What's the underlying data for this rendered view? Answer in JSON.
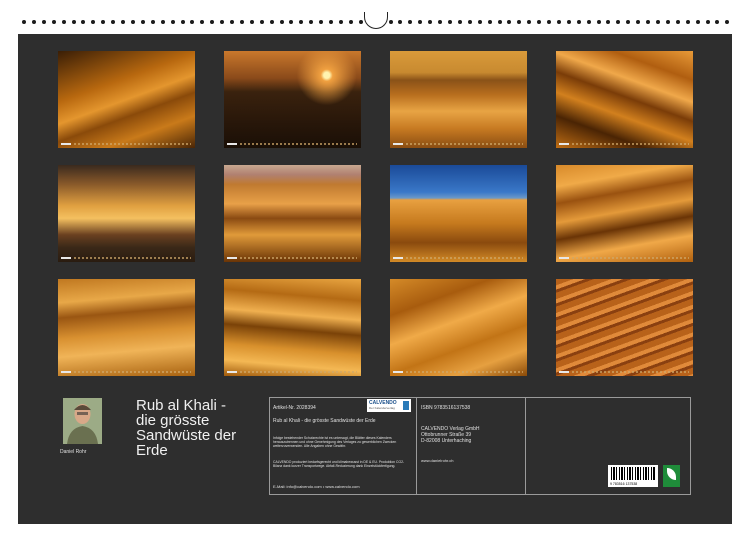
{
  "author": {
    "name": "Daniel Rohr"
  },
  "title": "Rub al Khali - die grösste Sandwüste der Erde",
  "title_lines": [
    "Rub al Khali -",
    "die grösste",
    "Sandwüste der",
    "Erde"
  ],
  "info": {
    "article": "Artikel-Nr. 2028394",
    "subtitle": "Rub al Khali - die grösste Sandwüste der Erde",
    "copyright": "Infolge bestehender Schutzrechte ist es untersagt, die Blätter dieses Kalenders herauszutrennen und ohne Genehmigung des Verlages zu gewerblichen Zwecken weiterzuverwenden. Alle Angaben ohne Gewähr.",
    "production": "CALVENDO produziert bedarfsgerecht und klimabewusst in DE & EU. Produktion CO2-Bilanz dank kurzer Transportwege. Abfall-Reduzierung dank Einzelstückfertigung.",
    "contact": "E-Mail: info@calvendo.com • www.calvendo.com",
    "isbn": "ISBN 9783516137538",
    "publisher": [
      "CALVENDO Verlag GmbH",
      "Ottobrunner Straße 39",
      "D-82008 Unterhaching"
    ],
    "website": "www.danielrohr.ch",
    "barcode_number": "9 783516 137538"
  },
  "logo": {
    "name": "CALVENDO",
    "tagline": "Der Kalenderverlag"
  },
  "colors": {
    "sheet": "#2e2e2e",
    "binding_dots": "#1b1b1b",
    "eco_badge": "#1f8c3a",
    "logo_accent": "#1a4f8a"
  },
  "photos": [
    {
      "subject": "desert dunes"
    },
    {
      "subject": "desert sunset"
    },
    {
      "subject": "desert panorama"
    },
    {
      "subject": "desert dunes"
    },
    {
      "subject": "desert sunset sky"
    },
    {
      "subject": "desert dunes"
    },
    {
      "subject": "desert dune under blue sky"
    },
    {
      "subject": "desert dunes"
    },
    {
      "subject": "desert dunes"
    },
    {
      "subject": "desert dune ridges"
    },
    {
      "subject": "desert dune"
    },
    {
      "subject": "sand ripples with dry plant"
    }
  ]
}
